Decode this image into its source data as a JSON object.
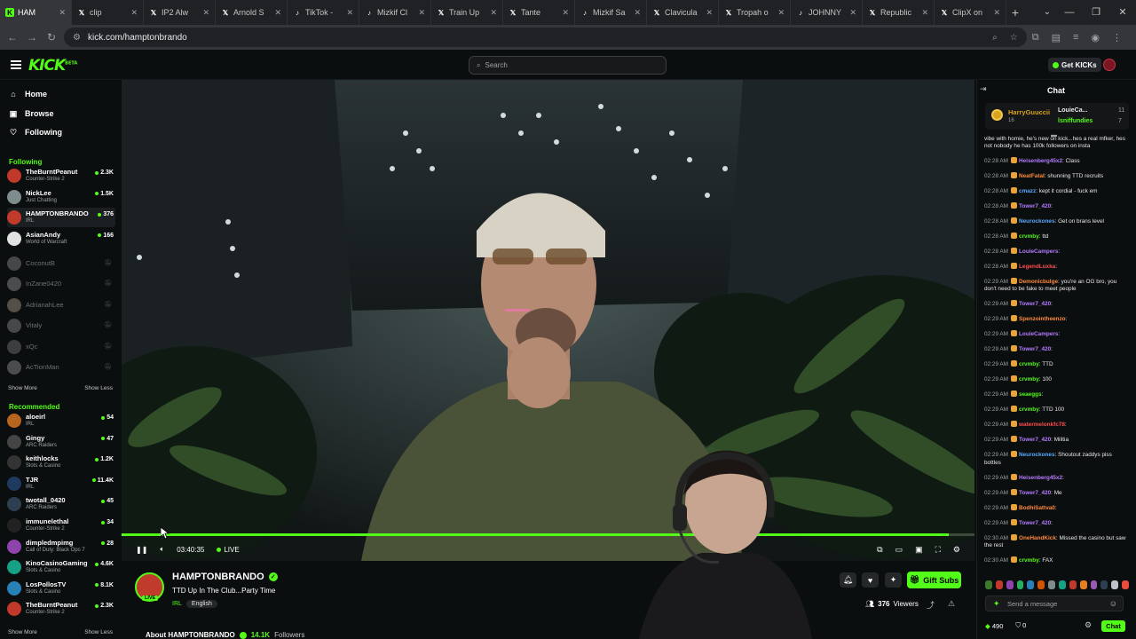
{
  "browser": {
    "tabs": [
      {
        "title": "HAM",
        "icon": "kick",
        "color": "#53fc18",
        "active": true
      },
      {
        "title": "clip",
        "icon": "x",
        "color": "#ffffff"
      },
      {
        "title": "IP2 Alw",
        "icon": "x",
        "color": "#ffffff"
      },
      {
        "title": "Arnold S",
        "icon": "x",
        "color": "#ffffff"
      },
      {
        "title": "TikTok -",
        "icon": "tiktok",
        "color": "#ffffff"
      },
      {
        "title": "Mizkif Cl",
        "icon": "tiktok",
        "color": "#ffffff"
      },
      {
        "title": "Train Up",
        "icon": "x",
        "color": "#ffffff"
      },
      {
        "title": "Tante",
        "icon": "x",
        "color": "#ffffff"
      },
      {
        "title": "Mizkif Sa",
        "icon": "tiktok",
        "color": "#ffffff"
      },
      {
        "title": "Clavicula",
        "icon": "x",
        "color": "#ffffff"
      },
      {
        "title": "Tropah o",
        "icon": "x",
        "color": "#ffffff"
      },
      {
        "title": "JOHNNY",
        "icon": "tiktok",
        "color": "#ffffff"
      },
      {
        "title": "Republic",
        "icon": "x",
        "color": "#ffffff"
      },
      {
        "title": "ClipX on",
        "icon": "x",
        "color": "#ffffff"
      }
    ],
    "url": "kick.com/hamptonbrando"
  },
  "header": {
    "logo": "KICK",
    "logo_sup": "BETA",
    "search_placeholder": "Search",
    "get_kicks": "Get KICKs"
  },
  "nav": {
    "home": "Home",
    "browse": "Browse",
    "following": "Following"
  },
  "sidebar": {
    "following_title": "Following",
    "following": [
      {
        "name": "TheBurntPeanut",
        "category": "Counter-Strike 2",
        "viewers": "2.3K",
        "color": "#c0392b"
      },
      {
        "name": "NickLee",
        "category": "Just Chatting",
        "viewers": "1.5K",
        "color": "#7f8c8d"
      },
      {
        "name": "HAMPTONBRANDO",
        "category": "IRL",
        "viewers": "376",
        "color": "#c03b2b",
        "selected": true
      },
      {
        "name": "AsianAndy",
        "category": "World of Warcraft",
        "viewers": "166",
        "color": "#e2e2e2"
      }
    ],
    "offline": [
      {
        "name": "CoconutB",
        "color": "#8e8e8e"
      },
      {
        "name": "InZane0420",
        "color": "#9a9a9a"
      },
      {
        "name": "AdrianahLee",
        "color": "#b0a090"
      },
      {
        "name": "Vitaly",
        "color": "#909090"
      },
      {
        "name": "xQc",
        "color": "#7a7a7a"
      },
      {
        "name": "AcTionMan",
        "color": "#999999"
      }
    ],
    "show_more": "Show More",
    "show_less": "Show Less",
    "recommended_title": "Recommended",
    "recommended": [
      {
        "name": "aloeirl",
        "category": "IRL",
        "viewers": "54",
        "color": "#b5651d"
      },
      {
        "name": "Gingy",
        "category": "ARC Raiders",
        "viewers": "47",
        "color": "#444444"
      },
      {
        "name": "keithlocks",
        "category": "Slots & Casino",
        "viewers": "1.2K",
        "color": "#333333"
      },
      {
        "name": "TJR",
        "category": "IRL",
        "viewers": "11.4K",
        "color": "#1f3a5f"
      },
      {
        "name": "twotall_0420",
        "category": "ARC Raiders",
        "viewers": "45",
        "color": "#2c3e50"
      },
      {
        "name": "immunelethal",
        "category": "Counter-Strike 2",
        "viewers": "34",
        "color": "#222222"
      },
      {
        "name": "dimpledmpimg",
        "category": "Call of Duty: Black Ops 7",
        "viewers": "28",
        "color": "#8e44ad"
      },
      {
        "name": "KinoCasinoGaming",
        "category": "Slots & Casino",
        "viewers": "4.6K",
        "color": "#16a085"
      },
      {
        "name": "LosPollosTV",
        "category": "Slots & Casino",
        "viewers": "8.1K",
        "color": "#2980b9"
      },
      {
        "name": "TheBurntPeanut",
        "category": "Counter-Strike 2",
        "viewers": "2.3K",
        "color": "#c0392b"
      }
    ],
    "show_more2": "Show More",
    "show_less2": "Show Less"
  },
  "player": {
    "time": "03:40:35",
    "live": "LIVE",
    "progress": 0.97
  },
  "stream": {
    "channel": "HAMPTONBRANDO",
    "title": "TTD Up In The Club...Party Time",
    "category": "IRL",
    "tag": "English",
    "live_badge": "LIVE",
    "gift_subs": "Gift Subs",
    "viewers": "376",
    "viewers_label": "Viewers",
    "about": "About HAMPTONBRANDO",
    "followers": "14.1K",
    "followers_label": "Followers"
  },
  "chat": {
    "title": "Chat",
    "pinned": {
      "name": "HarryGuuccii",
      "count": "16",
      "r1_name": "LouieCa...",
      "r1_count": "11",
      "r2_name": "lsniffundies",
      "r2_count": "7"
    },
    "messages": [
      {
        "ts": "",
        "user": "",
        "color": "#e8e8e8",
        "badge": "",
        "text": "vibe with homie, he's new on kick...hes a real mfker, hes not nobody he has 100k followers on insta"
      },
      {
        "ts": "02:28 AM",
        "user": "Heisenberg45x2",
        "color": "#b57bff",
        "badge": "#e8a33a",
        "text": "Class"
      },
      {
        "ts": "02:28 AM",
        "user": "NeatFatal",
        "color": "#ff8a3d",
        "badge": "#e8a33a",
        "text": "shunning TTD recruits"
      },
      {
        "ts": "02:28 AM",
        "user": "cmazz",
        "color": "#5aa9ff",
        "badge": "#e8a33a",
        "text": "kept it cordial - fuck em"
      },
      {
        "ts": "02:28 AM",
        "user": "Tower7_420",
        "color": "#b57bff",
        "badge": "#e8a33a",
        "text": ""
      },
      {
        "ts": "02:28 AM",
        "user": "Neurockones",
        "color": "#5aa9ff",
        "badge": "#e8a33a",
        "text": "Get on brans level"
      },
      {
        "ts": "02:28 AM",
        "user": "crvmby",
        "color": "#53fc18",
        "badge": "#e8a33a",
        "text": "ttd"
      },
      {
        "ts": "02:28 AM",
        "user": "LouieCampers",
        "color": "#b57bff",
        "badge": "#e8a33a",
        "text": ""
      },
      {
        "ts": "02:28 AM",
        "user": "LegendLuxka",
        "color": "#ff4d4d",
        "badge": "#e8a33a",
        "text": ""
      },
      {
        "ts": "02:29 AM",
        "user": "Demonicbulge",
        "color": "#ff8a3d",
        "badge": "#e8a33a",
        "text": "you're an OG bro, you don't need to be fake to meet people"
      },
      {
        "ts": "02:29 AM",
        "user": "Tower7_420",
        "color": "#b57bff",
        "badge": "#e8a33a",
        "text": ""
      },
      {
        "ts": "02:29 AM",
        "user": "Spenzointheenzo",
        "color": "#ff8a3d",
        "badge": "#e8a33a",
        "text": ""
      },
      {
        "ts": "02:29 AM",
        "user": "LouieCampers",
        "color": "#b57bff",
        "badge": "#e8a33a",
        "text": ""
      },
      {
        "ts": "02:29 AM",
        "user": "Tower7_420",
        "color": "#b57bff",
        "badge": "#e8a33a",
        "text": ""
      },
      {
        "ts": "02:29 AM",
        "user": "crvmby",
        "color": "#53fc18",
        "badge": "#e8a33a",
        "text": "TTD"
      },
      {
        "ts": "02:29 AM",
        "user": "crvmby",
        "color": "#53fc18",
        "badge": "#e8a33a",
        "text": "100"
      },
      {
        "ts": "02:29 AM",
        "user": "seaeggs",
        "color": "#53fc18",
        "badge": "#e8a33a",
        "text": ""
      },
      {
        "ts": "02:29 AM",
        "user": "crvmby",
        "color": "#53fc18",
        "badge": "#e8a33a",
        "text": "TTD 100"
      },
      {
        "ts": "02:29 AM",
        "user": "watermelonkfc78",
        "color": "#ff4d4d",
        "badge": "#e8a33a",
        "text": ""
      },
      {
        "ts": "02:29 AM",
        "user": "Tower7_420",
        "color": "#b57bff",
        "badge": "#e8a33a",
        "text": "Militia"
      },
      {
        "ts": "02:29 AM",
        "user": "Neurockones",
        "color": "#5aa9ff",
        "badge": "#e8a33a",
        "text": "Shoutout zaddys piss bottles"
      },
      {
        "ts": "02:29 AM",
        "user": "Heisenberg45x2",
        "color": "#b57bff",
        "badge": "#e8a33a",
        "text": ""
      },
      {
        "ts": "02:29 AM",
        "user": "Tower7_420",
        "color": "#b57bff",
        "badge": "#e8a33a",
        "text": "Me"
      },
      {
        "ts": "02:29 AM",
        "user": "BodhiSattva0",
        "color": "#ff8a3d",
        "badge": "#e8a33a",
        "text": ""
      },
      {
        "ts": "02:29 AM",
        "user": "Tower7_420",
        "color": "#b57bff",
        "badge": "#e8a33a",
        "text": ""
      },
      {
        "ts": "02:30 AM",
        "user": "OneHandKick",
        "color": "#ff8a3d",
        "badge": "#e8a33a",
        "text": "Missed the casino but saw the rest"
      },
      {
        "ts": "02:30 AM",
        "user": "crvmby",
        "color": "#53fc18",
        "badge": "#e8a33a",
        "text": "FAX"
      }
    ],
    "input_placeholder": "Send a message",
    "kicks": "490",
    "points": "0",
    "send_label": "Chat"
  },
  "colors": {
    "accent": "#53fc18",
    "bg": "#0b0e0f"
  }
}
